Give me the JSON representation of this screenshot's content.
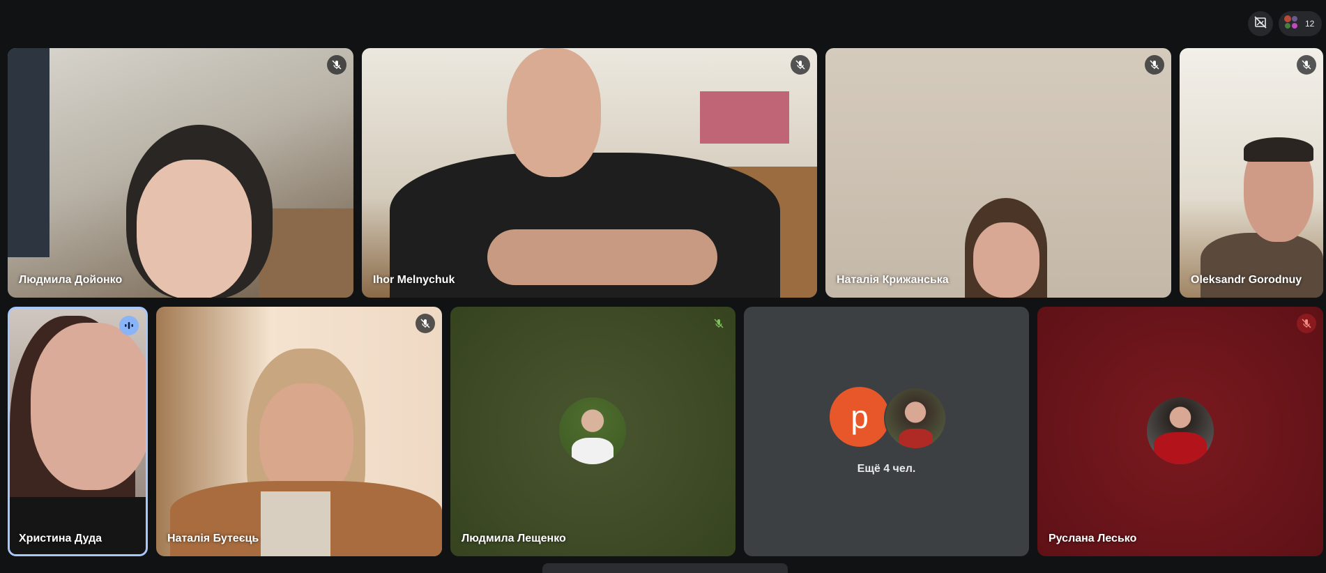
{
  "topbar": {
    "participant_count": "12",
    "layout_icon": "frame-off-icon",
    "people_icon": "people-avatars-icon"
  },
  "tiles": [
    {
      "name": "Людмила Дойонко",
      "muted": true
    },
    {
      "name": "Ihor Melnychuk",
      "muted": true
    },
    {
      "name": "Наталія Крижанська",
      "muted": true
    },
    {
      "name": "Oleksandr Gorodnuy",
      "muted": true
    },
    {
      "name": "Христина Дуда",
      "muted": false,
      "speaking": true
    },
    {
      "name": "Наталія Бутеєць",
      "muted": true
    },
    {
      "name": "Людмила Лещенко",
      "muted": true,
      "camera_off": true
    },
    {
      "name": "Руслана Лесько",
      "muted": true,
      "camera_off": true
    }
  ],
  "more": {
    "label": "Ещё 4 чел.",
    "avatar_letter": "p"
  },
  "colors": {
    "background": "#111214",
    "tile_green": "#3b4a26",
    "tile_gray": "#3c4043",
    "tile_red": "#6e1419",
    "active_border": "#a8c7fa",
    "avatar_orange": "#e8572a"
  }
}
